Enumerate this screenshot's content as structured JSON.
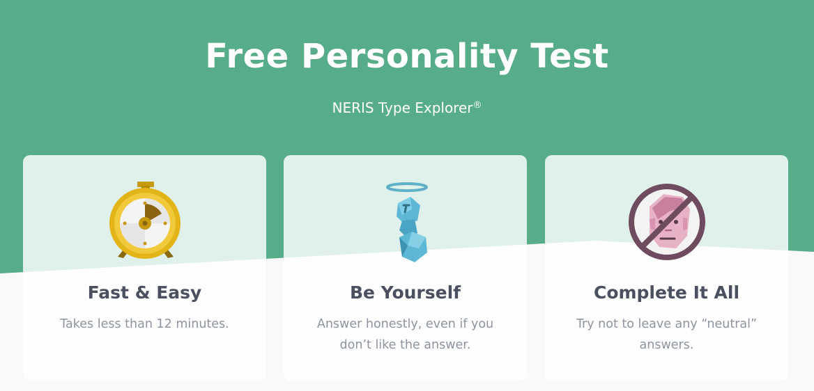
{
  "hero": {
    "title": "Free Personality Test",
    "subtitle": "NERIS Type Explorer",
    "subtitle_mark": "®"
  },
  "colors": {
    "hero_green": "#57ad8a",
    "page_bg": "#f9f9f9",
    "title_text": "#4a5060",
    "body_text": "#8d949e"
  },
  "cards": [
    {
      "icon": "stopwatch-icon",
      "title": "Fast & Easy",
      "text": "Takes less than 12 minutes."
    },
    {
      "icon": "halo-figure-icon",
      "title": "Be Yourself",
      "text": "Answer honestly, even if you don’t like the answer."
    },
    {
      "icon": "no-neutral-face-icon",
      "title": "Complete It All",
      "text": "Try not to leave any “neutral” answers."
    }
  ]
}
